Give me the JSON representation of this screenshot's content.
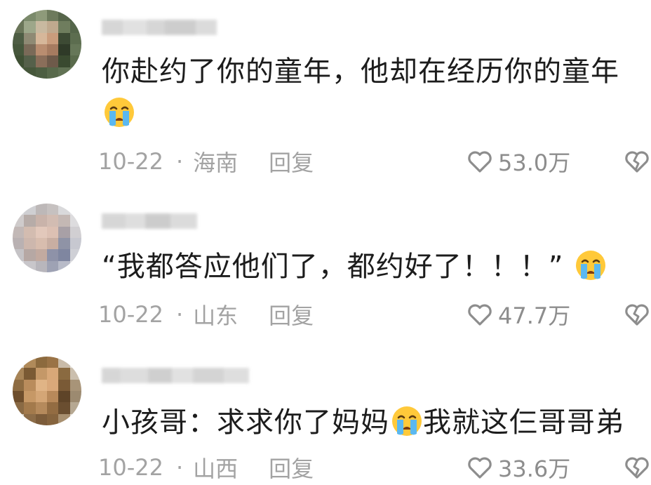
{
  "comments": [
    {
      "username": "",
      "text": "你赴约了你的童年，他却在经历你的童年",
      "emoji": "crying-face",
      "date": "10-22",
      "separator": "·",
      "location": "海南",
      "reply_label": "回复",
      "likes": "53.0万"
    },
    {
      "username": "",
      "text": "“我都答应他们了，都约好了！！！”",
      "emoji": "crying-face",
      "date": "10-22",
      "separator": "·",
      "location": "山东",
      "reply_label": "回复",
      "likes": "47.7万"
    },
    {
      "username": "",
      "text_before": "小孩哥：求求你了妈妈",
      "emoji": "crying-face",
      "text_after": "我就这仨哥哥弟",
      "date": "10-22",
      "separator": "·",
      "location": "山西",
      "reply_label": "回复",
      "likes": "33.6万"
    }
  ],
  "colors": {
    "text": "#1c1c1c",
    "meta": "#a3a3a3",
    "like": "#8d8d8d",
    "emoji_face": "#ffc93a",
    "emoji_tear": "#5bb8f0"
  }
}
